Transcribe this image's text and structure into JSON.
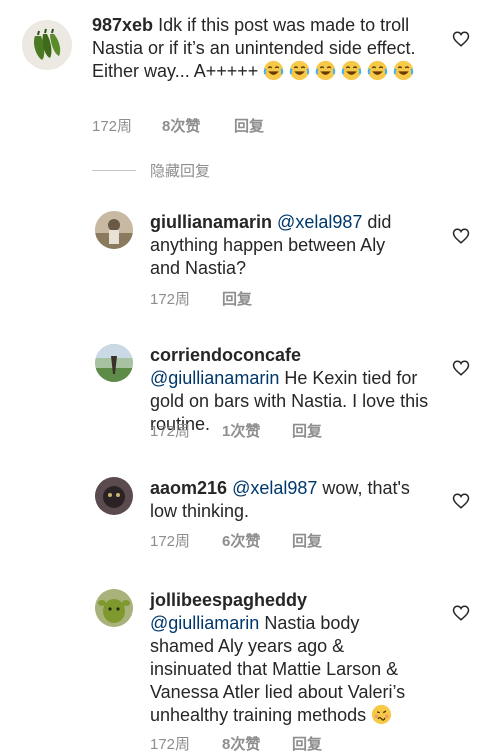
{
  "main_comment": {
    "username": "987xeb",
    "text": "Idk if this post was made to troll Nastia or if it’s an unintended side effect. Either way... A+++++",
    "emoji_count": 6,
    "time": "172周",
    "likes": "8次赞",
    "reply": "回复"
  },
  "hidden_replies": {
    "label": "隐藏回复"
  },
  "replies": [
    {
      "username": "giullianamarin",
      "mention": "@xelal987",
      "text": "did anything happen between Aly and Nastia?",
      "time": "172周",
      "likes": "",
      "reply": "回复"
    },
    {
      "username": "corriendoconcafe",
      "mention": "@giullianamarin",
      "text": "He Kexin tied for gold on bars with Nastia. I love this routine.",
      "time": "172周",
      "likes": "1次赞",
      "reply": "回复"
    },
    {
      "username": "aaom216",
      "mention": "@xelal987",
      "text": "wow, that's low thinking.",
      "time": "172周",
      "likes": "6次赞",
      "reply": "回复"
    },
    {
      "username": "jollibeespagheddy",
      "mention": "@giulliamarin",
      "text": "Nastia body shamed Aly years ago & insinuated that Mattie Larson & Vanessa Atler lied about Valeri’s unhealthy training methods",
      "time": "172周",
      "likes": "8次赞",
      "reply": "回复"
    }
  ],
  "icons": {
    "heart": "heart-outline-icon",
    "laugh": "face-with-tears-of-joy-icon",
    "woozy": "woozy-face-icon"
  },
  "colors": {
    "text": "#262626",
    "mention": "#00376b",
    "meta": "#8e8e8e"
  }
}
